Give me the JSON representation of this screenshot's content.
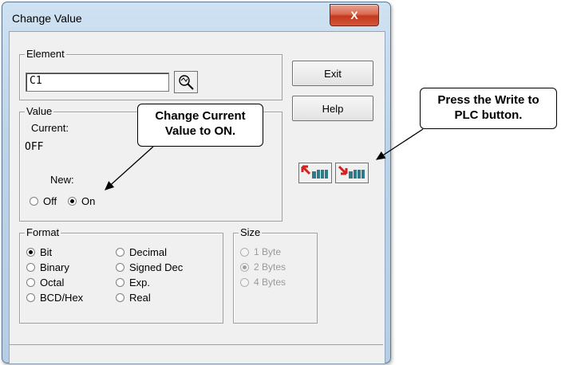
{
  "window": {
    "title": "Change Value",
    "close_glyph": "X"
  },
  "element": {
    "legend": "Element",
    "value": "C1",
    "lookup_icon": "magnifier-lookup-icon"
  },
  "value_group": {
    "legend": "Value",
    "current_label": "Current:",
    "current_value": "OFF",
    "new_label": "New:",
    "options": [
      {
        "label": "Off",
        "selected": false
      },
      {
        "label": "On",
        "selected": true
      }
    ]
  },
  "buttons": {
    "exit": "Exit",
    "help": "Help",
    "read_icon": "read-from-plc-icon",
    "write_icon": "write-to-plc-icon"
  },
  "format_group": {
    "legend": "Format",
    "options": [
      {
        "label": "Bit",
        "selected": true
      },
      {
        "label": "Decimal",
        "selected": false
      },
      {
        "label": "Binary",
        "selected": false
      },
      {
        "label": "Signed Dec",
        "selected": false
      },
      {
        "label": "Octal",
        "selected": false
      },
      {
        "label": "Exp.",
        "selected": false
      },
      {
        "label": "BCD/Hex",
        "selected": false
      },
      {
        "label": "Real",
        "selected": false
      }
    ]
  },
  "size_group": {
    "legend": "Size",
    "options": [
      {
        "label": "1 Byte",
        "selected": false
      },
      {
        "label": "2 Bytes",
        "selected": true
      },
      {
        "label": "4 Bytes",
        "selected": false
      }
    ],
    "enabled": false
  },
  "callouts": {
    "change_value": "Change Current Value to ON.",
    "write_plc": "Press the Write to PLC button."
  },
  "colors": {
    "title_gradient_top": "#cfe2f2",
    "close_red": "#c2391d",
    "dialog_face": "#f0f0f0"
  }
}
